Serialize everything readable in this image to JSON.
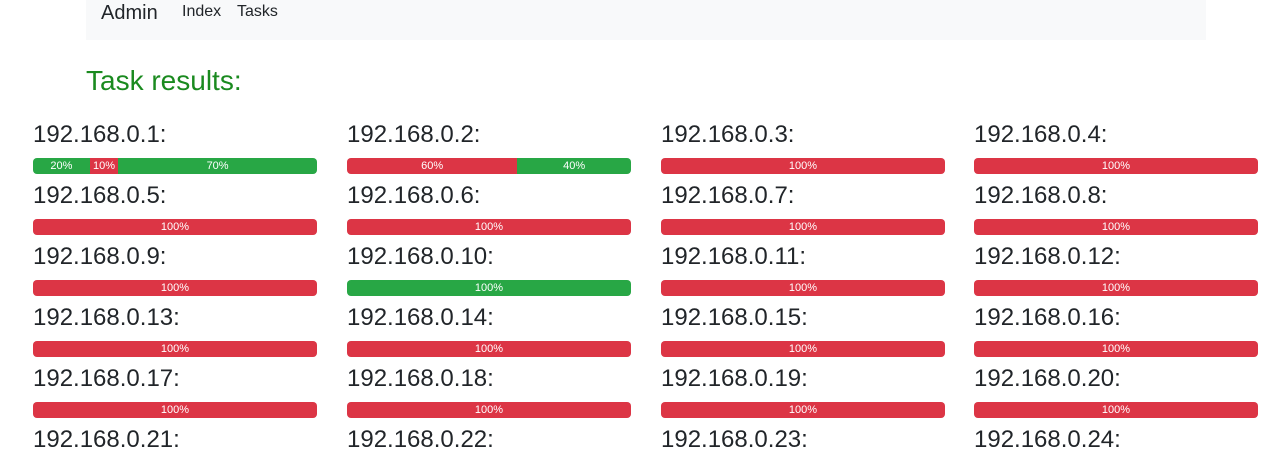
{
  "navbar": {
    "brand": "Admin",
    "links": [
      "Index",
      "Tasks"
    ]
  },
  "page": {
    "title": "Task results:"
  },
  "colors": {
    "success": "#28a745",
    "danger": "#dc3545",
    "title": "#1a8a1f"
  },
  "hosts": [
    {
      "label": "192.168.0.1:",
      "segments": [
        {
          "status": "success",
          "value": 20,
          "label": "20%"
        },
        {
          "status": "danger",
          "value": 10,
          "label": "10%"
        },
        {
          "status": "success",
          "value": 70,
          "label": "70%"
        }
      ]
    },
    {
      "label": "192.168.0.2:",
      "segments": [
        {
          "status": "danger",
          "value": 60,
          "label": "60%"
        },
        {
          "status": "success",
          "value": 40,
          "label": "40%"
        }
      ]
    },
    {
      "label": "192.168.0.3:",
      "segments": [
        {
          "status": "danger",
          "value": 100,
          "label": "100%"
        }
      ]
    },
    {
      "label": "192.168.0.4:",
      "segments": [
        {
          "status": "danger",
          "value": 100,
          "label": "100%"
        }
      ]
    },
    {
      "label": "192.168.0.5:",
      "segments": [
        {
          "status": "danger",
          "value": 100,
          "label": "100%"
        }
      ]
    },
    {
      "label": "192.168.0.6:",
      "segments": [
        {
          "status": "danger",
          "value": 100,
          "label": "100%"
        }
      ]
    },
    {
      "label": "192.168.0.7:",
      "segments": [
        {
          "status": "danger",
          "value": 100,
          "label": "100%"
        }
      ]
    },
    {
      "label": "192.168.0.8:",
      "segments": [
        {
          "status": "danger",
          "value": 100,
          "label": "100%"
        }
      ]
    },
    {
      "label": "192.168.0.9:",
      "segments": [
        {
          "status": "danger",
          "value": 100,
          "label": "100%"
        }
      ]
    },
    {
      "label": "192.168.0.10:",
      "segments": [
        {
          "status": "success",
          "value": 100,
          "label": "100%"
        }
      ]
    },
    {
      "label": "192.168.0.11:",
      "segments": [
        {
          "status": "danger",
          "value": 100,
          "label": "100%"
        }
      ]
    },
    {
      "label": "192.168.0.12:",
      "segments": [
        {
          "status": "danger",
          "value": 100,
          "label": "100%"
        }
      ]
    },
    {
      "label": "192.168.0.13:",
      "segments": [
        {
          "status": "danger",
          "value": 100,
          "label": "100%"
        }
      ]
    },
    {
      "label": "192.168.0.14:",
      "segments": [
        {
          "status": "danger",
          "value": 100,
          "label": "100%"
        }
      ]
    },
    {
      "label": "192.168.0.15:",
      "segments": [
        {
          "status": "danger",
          "value": 100,
          "label": "100%"
        }
      ]
    },
    {
      "label": "192.168.0.16:",
      "segments": [
        {
          "status": "danger",
          "value": 100,
          "label": "100%"
        }
      ]
    },
    {
      "label": "192.168.0.17:",
      "segments": [
        {
          "status": "danger",
          "value": 100,
          "label": "100%"
        }
      ]
    },
    {
      "label": "192.168.0.18:",
      "segments": [
        {
          "status": "danger",
          "value": 100,
          "label": "100%"
        }
      ]
    },
    {
      "label": "192.168.0.19:",
      "segments": [
        {
          "status": "danger",
          "value": 100,
          "label": "100%"
        }
      ]
    },
    {
      "label": "192.168.0.20:",
      "segments": [
        {
          "status": "danger",
          "value": 100,
          "label": "100%"
        }
      ]
    },
    {
      "label": "192.168.0.21:",
      "segments": []
    },
    {
      "label": "192.168.0.22:",
      "segments": []
    },
    {
      "label": "192.168.0.23:",
      "segments": []
    },
    {
      "label": "192.168.0.24:",
      "segments": []
    }
  ]
}
